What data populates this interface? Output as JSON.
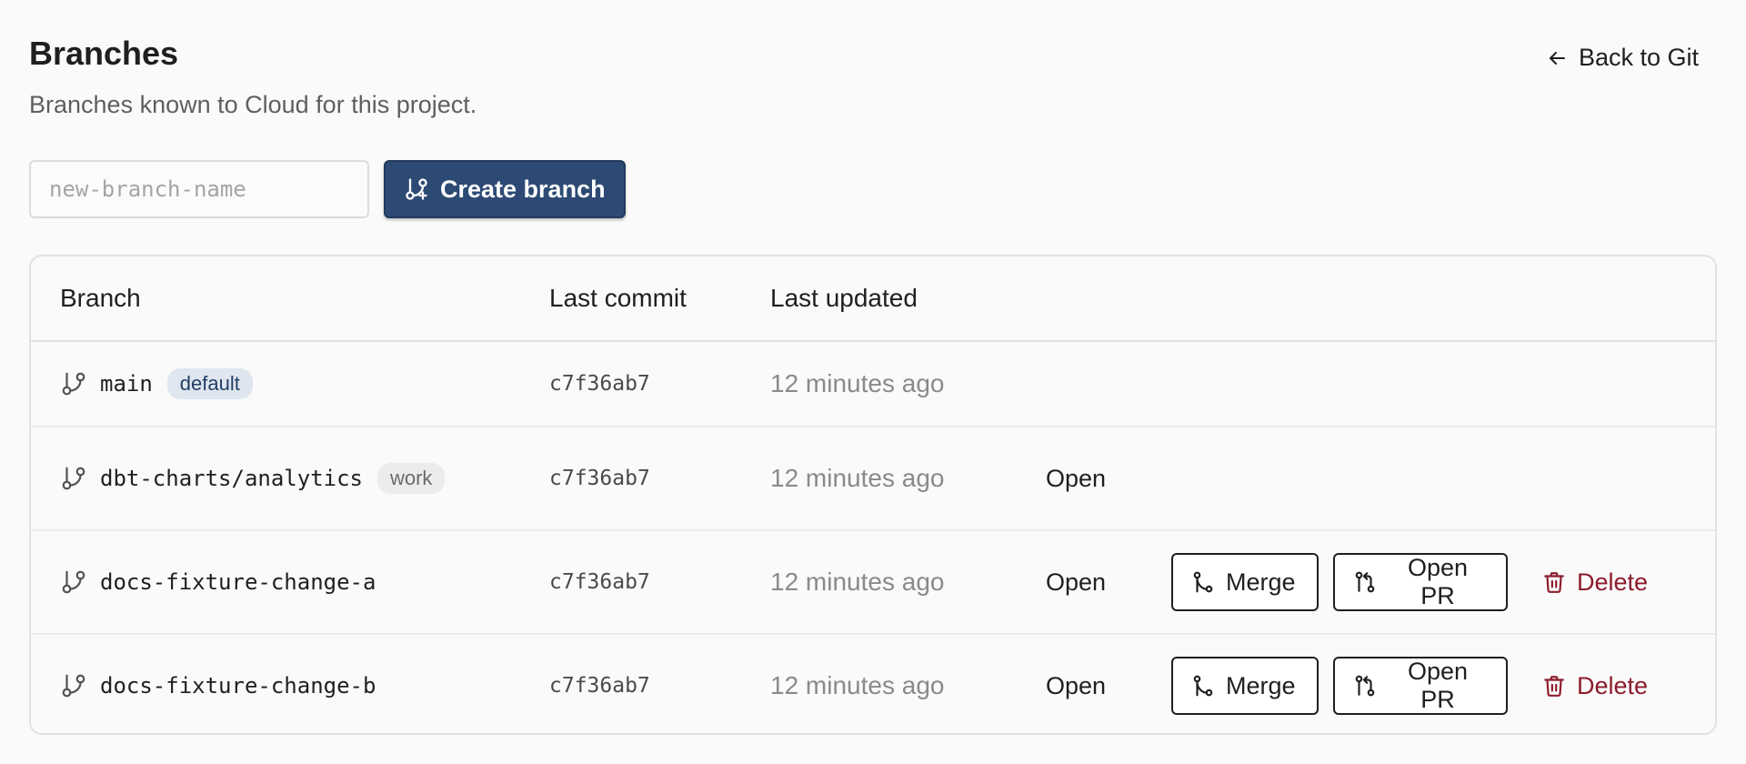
{
  "header": {
    "title": "Branches",
    "subtitle": "Branches known to Cloud for this project.",
    "back_label": "Back to Git"
  },
  "create": {
    "placeholder": "new-branch-name",
    "button_label": "Create branch"
  },
  "table": {
    "columns": [
      "Branch",
      "Last commit",
      "Last updated"
    ],
    "rows": [
      {
        "name": "main",
        "badge": "default",
        "commit": "c7f36ab7",
        "updated": "12 minutes ago",
        "status": "",
        "merge_label": "",
        "pr_label": "",
        "delete_label": ""
      },
      {
        "name": "dbt-charts/analytics",
        "badge": "work",
        "commit": "c7f36ab7",
        "updated": "12 minutes ago",
        "status": "Open",
        "merge_label": "",
        "pr_label": "",
        "delete_label": ""
      },
      {
        "name": "docs-fixture-change-a",
        "badge": "",
        "commit": "c7f36ab7",
        "updated": "12 minutes ago",
        "status": "Open",
        "merge_label": "Merge",
        "pr_label": "Open PR",
        "delete_label": "Delete"
      },
      {
        "name": "docs-fixture-change-b",
        "badge": "",
        "commit": "c7f36ab7",
        "updated": "12 minutes ago",
        "status": "Open",
        "merge_label": "Merge",
        "pr_label": "Open PR",
        "delete_label": "Delete"
      }
    ]
  },
  "colors": {
    "primary": "#2d4a74",
    "danger": "#8c1c2c",
    "default_badge_bg": "#dfe6ef",
    "work_badge_bg": "#ececec",
    "muted_text": "#8a8a8a"
  },
  "icons": {
    "back": "arrow-left-icon",
    "create": "git-branch-plus-icon",
    "branch": "git-branch-icon",
    "merge": "git-merge-icon",
    "pr": "git-pull-request-icon",
    "delete": "trash-icon"
  }
}
